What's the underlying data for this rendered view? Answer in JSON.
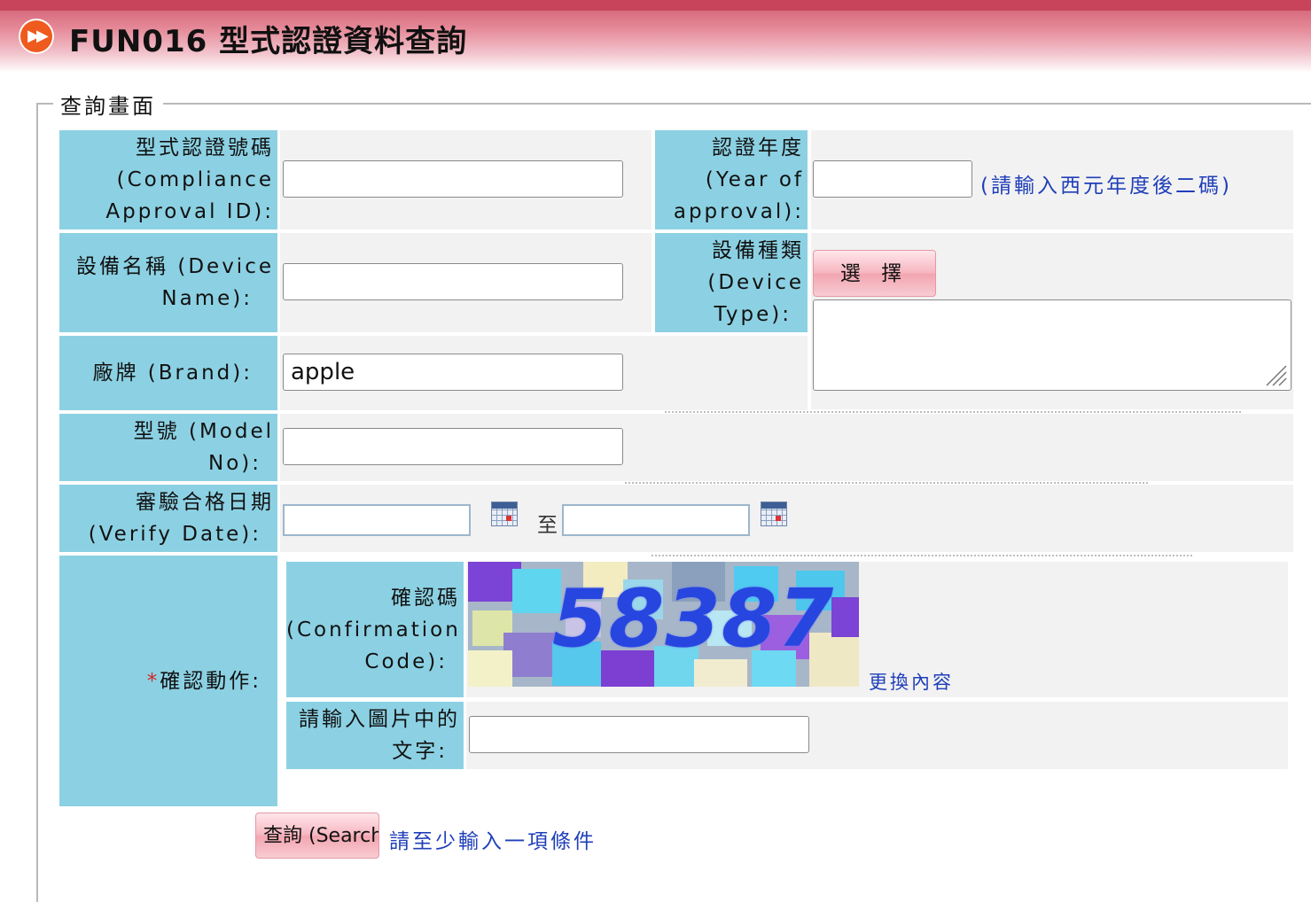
{
  "header": {
    "title": "FUN016 型式認證資料查詢",
    "icon": "fast-forward-icon"
  },
  "form": {
    "legend": "查詢畫面",
    "compliance_id": {
      "label_zh": "型式認證號碼",
      "label_en1": "(Compliance",
      "label_en2": "Approval ID):",
      "value": ""
    },
    "year": {
      "label_zh": "認證年度",
      "label_en1": "(Year of",
      "label_en2": "approval):",
      "value": "",
      "hint": "(請輸入西元年度後二碼)"
    },
    "device_name": {
      "label_line1": "設備名稱 (Device",
      "label_line2": "Name):",
      "value": ""
    },
    "device_type": {
      "label_zh": "設備種類",
      "label_en1": "(Device",
      "label_en2": "Type):",
      "select_button": "選 擇",
      "value": ""
    },
    "brand": {
      "label": "廠牌 (Brand):",
      "value": "apple"
    },
    "model": {
      "label_line1": "型號 (Model",
      "label_line2": "No):",
      "value": ""
    },
    "verify_date": {
      "label_zh": "審驗合格日期",
      "label_en": "(Verify Date):",
      "separator": "至",
      "from": "",
      "to": ""
    },
    "confirm": {
      "required_mark": "*",
      "label": "確認動作:",
      "code_label_zh": "確認碼",
      "code_label_en1": "(Confirmation",
      "code_label_en2": "Code):",
      "captcha_text": "58387",
      "refresh_link": "更換內容",
      "input_label_line1": "請輸入圖片中的",
      "input_label_line2": "文字:",
      "input_value": ""
    },
    "search_button": "查詢 (Search)",
    "search_hint": "請至少輸入一項條件"
  },
  "colors": {
    "label_bg": "#8cd1e3",
    "cell_bg": "#f2f2f2",
    "header_red": "#c7445b",
    "link_blue": "#1f3fb9",
    "icon_orange": "#ef5a1e"
  }
}
